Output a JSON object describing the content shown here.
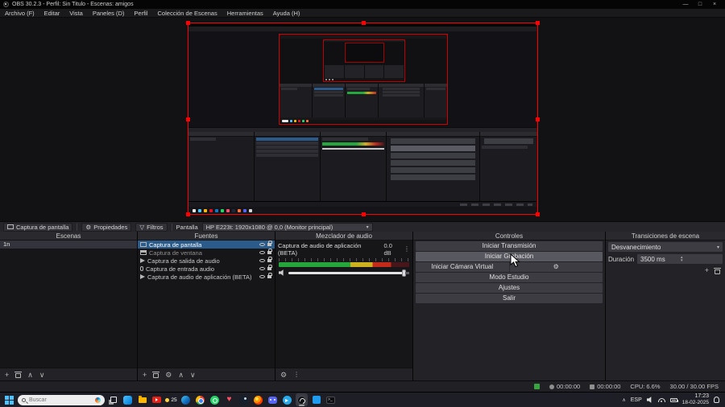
{
  "window": {
    "title": "OBS 30.2.3 - Perfil: Sin Titulo - Escenas: amigos"
  },
  "icons": {
    "minimize": "—",
    "maximize": "□",
    "close": "×",
    "plus": "+",
    "gear": "⚙",
    "up": "∧",
    "down": "∨",
    "kebab": "⋮",
    "caret_down": "▾",
    "caret_up": "▴",
    "filter": "▽",
    "chevron_up": "∧",
    "heart": "♥",
    "terminal": ">_"
  },
  "menu": {
    "items": [
      "Archivo (F)",
      "Editar",
      "Vista",
      "Paneles (D)",
      "Perfil",
      "Colección de Escenas",
      "Herramientas",
      "Ayuda (H)"
    ]
  },
  "srcbar": {
    "tab": "Captura de pantalla",
    "properties": "Propiedades",
    "filters": "Filtros",
    "screen_label": "Pantalla",
    "screen_value": "HP E223t: 1920x1080 @ 0,0 (Monitor principal)"
  },
  "scenes": {
    "title": "Escenas",
    "items": [
      {
        "name": "1n"
      }
    ]
  },
  "sources": {
    "title": "Fuentes",
    "items": [
      {
        "name": "Captura de pantalla"
      },
      {
        "name": "Captura de ventana"
      },
      {
        "name": "Captura de salida de audio"
      },
      {
        "name": "Captura de entrada audio"
      },
      {
        "name": "Captura de audio de aplicación (BETA)"
      }
    ]
  },
  "mixer": {
    "title": "Mezclador de audio",
    "channel": "Captura de audio de aplicación (BETA)",
    "level": "0.0 dB"
  },
  "controls": {
    "title": "Controles",
    "buttons": [
      "Iniciar Transmisión",
      "Iniciar Grabación",
      "Iniciar Cámara Virtual",
      "Modo Estudio",
      "Ajustes",
      "Salir"
    ]
  },
  "transitions": {
    "title": "Transiciones de escena",
    "selected": "Desvanecimiento",
    "duration_label": "Duración",
    "duration_value": "3500 ms"
  },
  "status": {
    "rec_time": "00:00:00",
    "stream_time": "00:00:00",
    "cpu": "CPU: 6.6%",
    "fps": "30.00 / 30.00 FPS"
  },
  "taskbar": {
    "search": "Buscar",
    "weather": "25",
    "lang": "ESP",
    "time": "17:23",
    "date": "18-02-2025"
  },
  "colors": {
    "accent_red": "#ff0000",
    "selection_blue": "#2b5b8a",
    "meter_green": "#26a53c"
  }
}
